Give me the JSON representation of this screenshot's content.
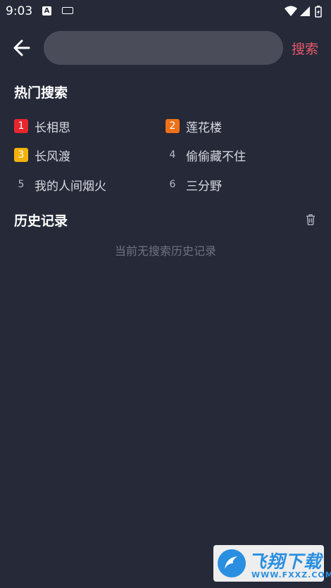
{
  "status_bar": {
    "time": "9:03",
    "a_glyph": "A"
  },
  "search": {
    "value": "",
    "placeholder": "",
    "button_label": "搜索"
  },
  "hot": {
    "title": "热门搜索",
    "items": [
      {
        "rank": "1",
        "label": "长相思",
        "badge_color": "#e8262d"
      },
      {
        "rank": "2",
        "label": "莲花楼",
        "badge_color": "#f07018"
      },
      {
        "rank": "3",
        "label": "长风渡",
        "badge_color": "#f3b20c"
      },
      {
        "rank": "4",
        "label": "偷偷藏不住",
        "badge_color": ""
      },
      {
        "rank": "5",
        "label": "我的人间烟火",
        "badge_color": ""
      },
      {
        "rank": "6",
        "label": "三分野",
        "badge_color": ""
      }
    ]
  },
  "history": {
    "title": "历史记录",
    "empty_text": "当前无搜索历史记录"
  },
  "watermark": {
    "name": "飞翔下载",
    "url": "WWW.FXXZ.COM"
  },
  "colors": {
    "background": "#252938",
    "accent": "#e85a6a",
    "input_bg": "#4a4d59"
  },
  "icons": [
    "arrow-left-icon",
    "trash-icon",
    "wifi-icon",
    "signal-icon",
    "battery-icon",
    "keyboard-icon"
  ]
}
